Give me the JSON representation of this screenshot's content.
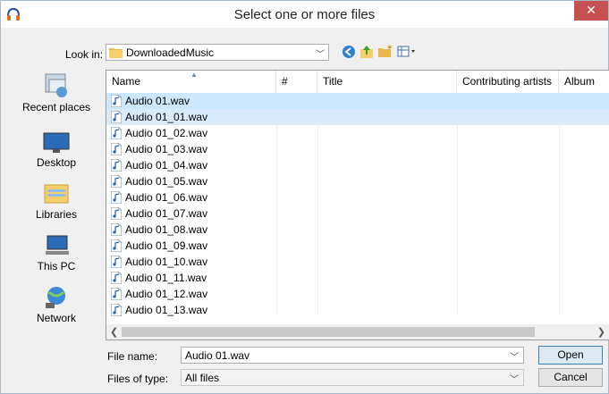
{
  "window": {
    "title": "Select one or more files",
    "close": "✕"
  },
  "lookin": {
    "label": "Look in:",
    "value": "DownloadedMusic"
  },
  "toolbar": {
    "icons": [
      "back-icon",
      "up-folder-icon",
      "new-folder-icon",
      "view-menu-icon"
    ]
  },
  "places": [
    {
      "label": "Recent places",
      "icon": "recent-places-icon"
    },
    {
      "label": "Desktop",
      "icon": "desktop-icon"
    },
    {
      "label": "Libraries",
      "icon": "libraries-icon"
    },
    {
      "label": "This PC",
      "icon": "this-pc-icon"
    },
    {
      "label": "Network",
      "icon": "network-icon"
    }
  ],
  "columns": [
    "Name",
    "#",
    "Title",
    "Contributing artists",
    "Album"
  ],
  "files": [
    "Audio 01.wav",
    "Audio 01_01.wav",
    "Audio 01_02.wav",
    "Audio 01_03.wav",
    "Audio 01_04.wav",
    "Audio 01_05.wav",
    "Audio 01_06.wav",
    "Audio 01_07.wav",
    "Audio 01_08.wav",
    "Audio 01_09.wav",
    "Audio 01_10.wav",
    "Audio 01_11.wav",
    "Audio 01_12.wav",
    "Audio 01_13.wav"
  ],
  "selected_rows": [
    0,
    1
  ],
  "filename": {
    "label": "File name:",
    "value": "Audio 01.wav"
  },
  "filetype": {
    "label": "Files of type:",
    "value": "All files"
  },
  "buttons": {
    "open": "Open",
    "cancel": "Cancel"
  },
  "colors": {
    "selection": "#cce8ff",
    "close": "#c75050",
    "folder": "#e8b84a"
  }
}
